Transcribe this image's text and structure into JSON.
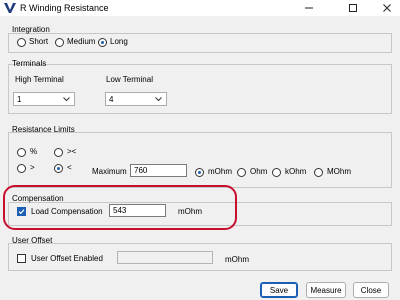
{
  "window": {
    "title": "R Winding Resistance",
    "minimize_icon": "minimize-icon",
    "maximize_icon": "maximize-icon",
    "close_icon": "close-icon"
  },
  "integration": {
    "label": "Integration",
    "options": [
      {
        "label": "Short",
        "selected": false
      },
      {
        "label": "Medium",
        "selected": false
      },
      {
        "label": "Long",
        "selected": true
      }
    ]
  },
  "terminals": {
    "label": "Terminals",
    "high": {
      "label": "High Terminal",
      "value": "1"
    },
    "low": {
      "label": "Low Terminal",
      "value": "4"
    }
  },
  "resistance_limits": {
    "label": "Resistance Limits",
    "operators": [
      {
        "label": "%",
        "selected": false
      },
      {
        "label": "><",
        "selected": false
      },
      {
        "label": ">",
        "selected": false
      },
      {
        "label": "<",
        "selected": true
      }
    ],
    "maximum": {
      "label": "Maximum",
      "value": "760"
    },
    "units": [
      {
        "label": "mOhm",
        "selected": true
      },
      {
        "label": "Ohm",
        "selected": false
      },
      {
        "label": "kOhm",
        "selected": false
      },
      {
        "label": "MOhm",
        "selected": false
      }
    ]
  },
  "compensation": {
    "label": "Compensation",
    "load": {
      "label": "Load Compensation",
      "checked": true,
      "value": "543",
      "unit": "mOhm"
    }
  },
  "user_offset": {
    "label": "User Offset",
    "enabled": {
      "label": "User Offset Enabled",
      "checked": false,
      "value": "",
      "unit": "mOhm"
    }
  },
  "buttons": {
    "save": "Save",
    "measure": "Measure",
    "close": "Close"
  },
  "colors": {
    "accent": "#1a5fb4",
    "highlight": "#c8102e"
  }
}
